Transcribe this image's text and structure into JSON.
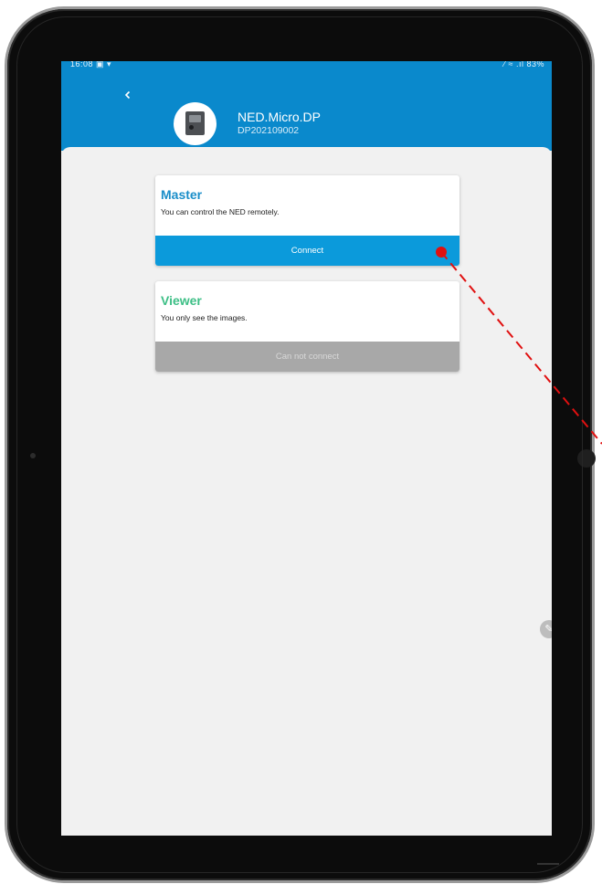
{
  "status_bar": {
    "time": "16:08",
    "left_icons": "▣ ▾",
    "right_text": "⁄ ≈ .ıl 83%"
  },
  "header": {
    "back_icon": "chevron-left-icon",
    "device_name": "NED.Micro.DP",
    "device_serial": "DP202109002"
  },
  "cards": {
    "master": {
      "title": "Master",
      "description": "You can control the NED remotely.",
      "action_label": "Connect"
    },
    "viewer": {
      "title": "Viewer",
      "description": "You only see the images.",
      "action_label": "Can not connect"
    }
  },
  "floating_button": {
    "icon": "pencil-icon",
    "glyph": "✎"
  },
  "colors": {
    "header_blue": "#0a89cc",
    "master_title": "#1a8ec9",
    "viewer_title": "#3dbf86",
    "connect_button": "#0b9adb",
    "disabled_button": "#a8a8a8",
    "annotation_red": "#e01010"
  }
}
